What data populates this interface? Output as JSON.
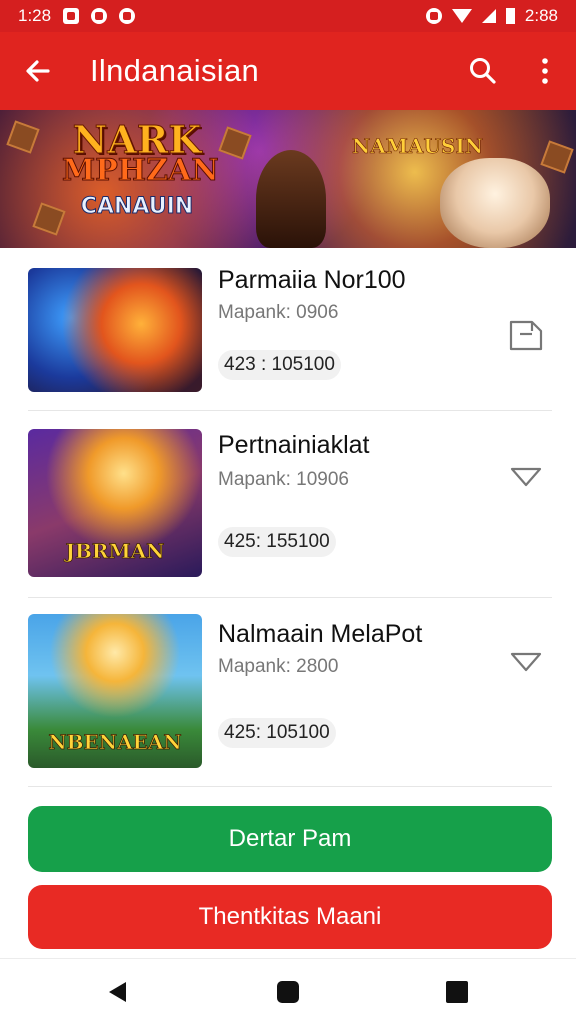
{
  "status_bar": {
    "time": "1:28",
    "right_text": "2:88"
  },
  "app_bar": {
    "title": "Ilndanaisian"
  },
  "icons": {
    "back": "arrow-left",
    "search": "magnifier",
    "menu": "vertical-dots",
    "bookmark": "bookmark-outline",
    "expand": "triangle-down"
  },
  "colors": {
    "app_bar": "#e0241f",
    "primary_button": "#16a04a",
    "secondary_button": "#e82a24"
  },
  "banner": {
    "logo_line1": "NARK",
    "logo_line2": "MPHZAN",
    "logo_line3": "CANAUIN",
    "tagline": "NAMAUSIN"
  },
  "items": [
    {
      "title": "Parmaiia Nor100",
      "subtitle": "Mapank: 0906",
      "price": "423 : 105100",
      "thumb_title": ""
    },
    {
      "title": "Pertnainiaklat",
      "subtitle": "Mapank: 10906",
      "price": "425: 155100",
      "thumb_title": "JBRMAN"
    },
    {
      "title": "Nalmaain MelaPot",
      "subtitle": "Mapank: 2800",
      "price": "425: 105100",
      "thumb_title": "NBENAEAN"
    }
  ],
  "buttons": {
    "primary": "Dertar Pam",
    "secondary": "Thentkitas Maani"
  }
}
